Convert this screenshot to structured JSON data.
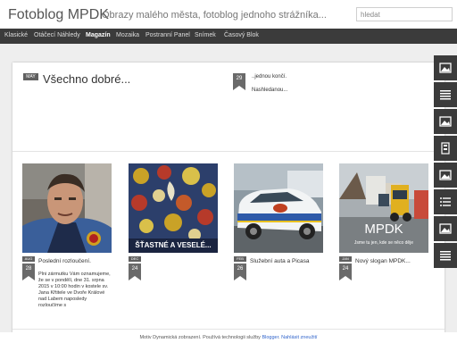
{
  "header": {
    "title": "Fotoblog MPDK",
    "description": "Obrazy malého města, fotoblog jednoho strážníka...",
    "search_placeholder": "hledat"
  },
  "nav": {
    "items": [
      {
        "label": "Klasické"
      },
      {
        "label": "Otáčecí Náhledy"
      },
      {
        "label": "Magazín"
      },
      {
        "label": "Mozaika"
      },
      {
        "label": "Postranní Panel"
      },
      {
        "label": "Snímek"
      },
      {
        "label": "Časový Blok"
      }
    ],
    "active": "Magazín"
  },
  "main_post": {
    "month": "MAY",
    "title": "Všechno dobré...",
    "day": "29",
    "snippet_line1": "..jednou končí.",
    "snippet_line2": "Nashledanou..."
  },
  "cards": [
    {
      "month": "AUG",
      "day": "28",
      "title": "Poslední rozloučení.",
      "text": "Plni zármutku Vám oznamujeme, že se v pondělí, dne 31. srpna 2015 v 10:00 hodin v kostele sv. Jana Křtitele ve Dvoře Králové nad Labem naposledy rozloučíme s"
    },
    {
      "month": "DEC",
      "day": "24",
      "title": "",
      "text": "",
      "image_caption": "ŠŤASTNÉ A VESELÉ..."
    },
    {
      "month": "FEB",
      "day": "26",
      "title": "Služební auta a Picasa",
      "text": ""
    },
    {
      "month": "JAN",
      "day": "24",
      "title": "Nový slogan MPDK...",
      "text": "",
      "image_caption": "MPDK",
      "image_subcaption": "Jsme tu jen, kde se něco děje"
    }
  ],
  "footer": {
    "text": "Motiv Dynamická zobrazení. Používá technologii služby",
    "blogger_link": "Blogger",
    "report_link": "Nahlásit zneužití"
  },
  "side_tools": [
    "image-icon",
    "list-icon",
    "image-icon",
    "gadget-icon",
    "image-icon",
    "list-icon",
    "image-icon",
    "list-icon"
  ],
  "colors": {
    "nav_bg": "#3b3b3b",
    "page_bg": "#eeeeee",
    "badge": "#606060",
    "link": "#3366cc"
  }
}
